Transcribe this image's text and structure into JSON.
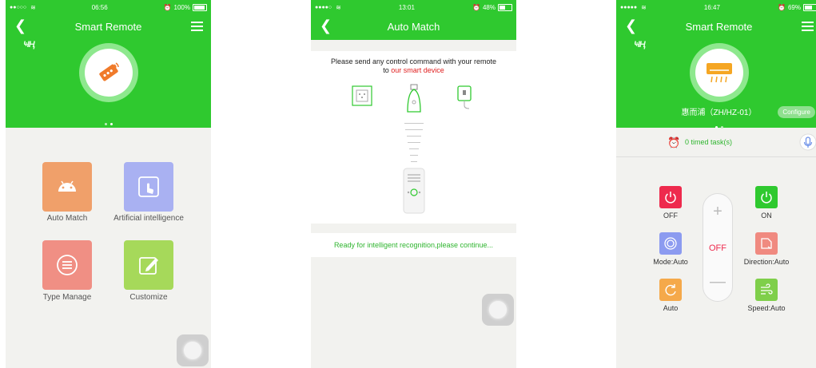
{
  "screen1": {
    "status": {
      "signal": "●●○○○",
      "time": "06:56",
      "battery": "100%"
    },
    "nav": {
      "title": "Smart Remote"
    },
    "brand": "ҸҢ",
    "tiles": [
      {
        "label": "Auto Match",
        "color": "#f0a06a"
      },
      {
        "label": "Artificial intelligence",
        "color": "#a9b1f2"
      },
      {
        "label": "Type Manage",
        "color": "#f08f84"
      },
      {
        "label": "Customize",
        "color": "#a6d95a"
      }
    ]
  },
  "screen2": {
    "status": {
      "signal": "●●●●○",
      "time": "13:01",
      "battery": "48%"
    },
    "nav": {
      "title": "Auto Match"
    },
    "instruction_line1": "Please send any control command with your remote",
    "instruction_prefix": "to ",
    "instruction_highlight": "our smart device",
    "ready_text": "Ready for intelligent recognition,please continue..."
  },
  "screen3": {
    "status": {
      "signal": "●●●●●",
      "time": "16:47",
      "battery": "69%"
    },
    "nav": {
      "title": "Smart Remote"
    },
    "brand": "ҸҢ",
    "device_name": "惠而浦（ZH/HZ-01）",
    "configure_label": "Configure",
    "timed_tasks": "0 timed task(s)",
    "center_state": "OFF",
    "buttons": [
      {
        "label": "OFF",
        "color": "#ee2a4d"
      },
      {
        "label": "ON",
        "color": "#2fc92f"
      },
      {
        "label": "Mode:Auto",
        "color": "#8c9bf0"
      },
      {
        "label": "Direction:Auto",
        "color": "#f08a80"
      },
      {
        "label": "Auto",
        "color": "#f5a94a"
      },
      {
        "label": "Speed:Auto",
        "color": "#7fcf4a"
      }
    ]
  },
  "colors": {
    "brand_green": "#2fc92f",
    "background": "#f2f2ef"
  }
}
